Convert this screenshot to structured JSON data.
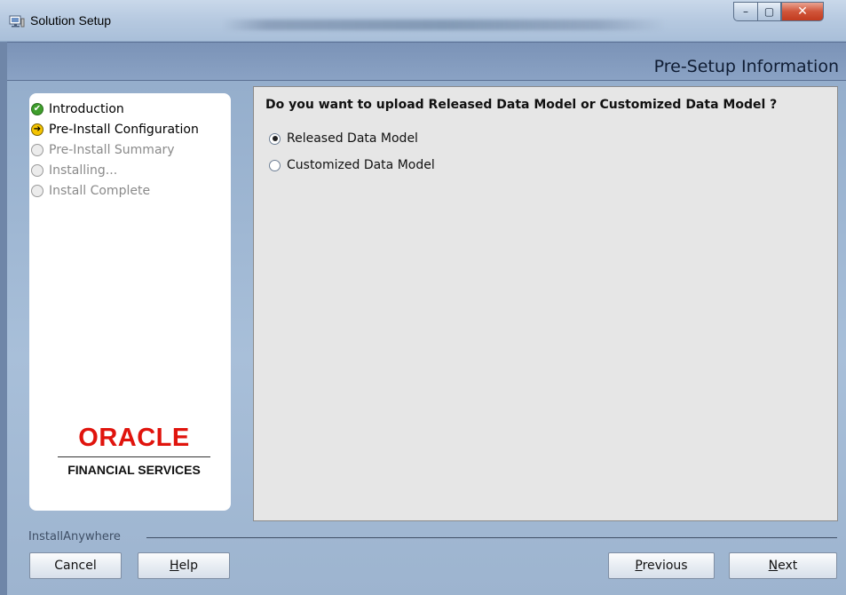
{
  "window": {
    "title": "Solution Setup",
    "caption": {
      "minimize": "–",
      "maximize": "▢",
      "close": "✕"
    }
  },
  "header": {
    "title": "Pre-Setup Information"
  },
  "steps": [
    {
      "label": "Introduction",
      "state": "done"
    },
    {
      "label": "Pre-Install Configuration",
      "state": "current"
    },
    {
      "label": "Pre-Install Summary",
      "state": "pending"
    },
    {
      "label": "Installing...",
      "state": "pending"
    },
    {
      "label": "Install Complete",
      "state": "pending"
    }
  ],
  "logo": {
    "brand": "ORACLE",
    "subtitle": "FINANCIAL SERVICES"
  },
  "content": {
    "question": "Do you want to upload Released Data Model or Customized Data Model ?",
    "options": [
      {
        "label": "Released Data Model",
        "selected": true
      },
      {
        "label": "Customized Data Model",
        "selected": false
      }
    ]
  },
  "footer": {
    "label": "InstallAnywhere",
    "cancel": "Cancel",
    "help": "Help",
    "previous": "Previous",
    "next": "Next"
  },
  "colors": {
    "header_band": "#7b93b7",
    "oracle_red": "#e0140d",
    "step_done": "#3f9e2c",
    "step_current": "#f5c400"
  }
}
